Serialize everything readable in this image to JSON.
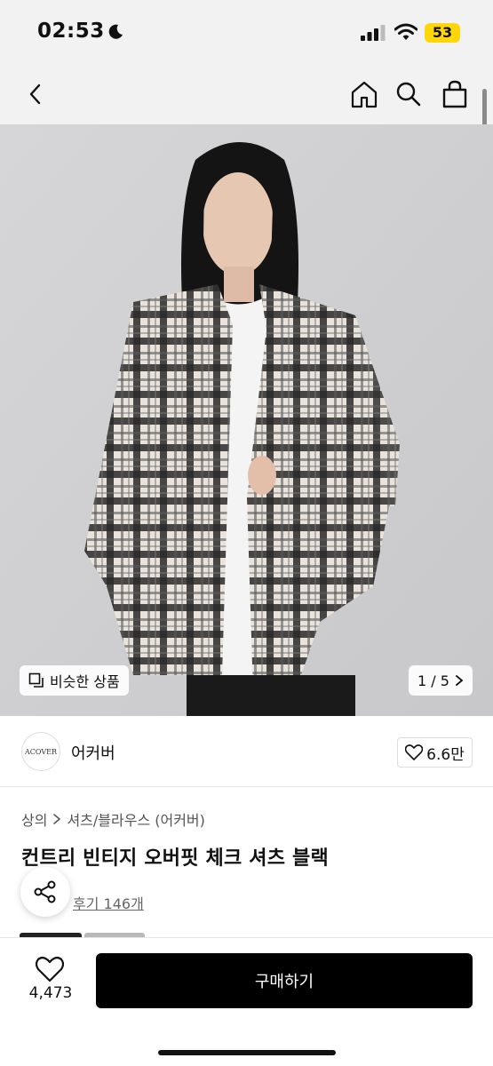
{
  "status_bar": {
    "time": "02:53",
    "battery_level": "53",
    "icons": [
      "moon-icon",
      "signal-icon",
      "wifi-icon",
      "battery-icon"
    ]
  },
  "nav": {
    "icons": [
      "back-arrow-icon",
      "home-icon",
      "search-icon",
      "shopping-bag-icon"
    ]
  },
  "hero": {
    "similar_label": "비슷한 상품",
    "pager": "1 / 5"
  },
  "brand": {
    "logo_text": "ACOVER",
    "name": "어커버",
    "likes": "6.6만"
  },
  "product": {
    "breadcrumb": [
      "상의",
      "셔츠/블라우스 (어커버)"
    ],
    "title": "컨트리 빈티지 오버핏 체크 셔츠 블랙",
    "reviews": "후기 146개"
  },
  "bottom": {
    "wish_count": "4,473",
    "buy_label": "구매하기"
  },
  "colors": {
    "accent": "#000000",
    "battery": "#ffd60a",
    "surface": "#f2f2f2"
  }
}
